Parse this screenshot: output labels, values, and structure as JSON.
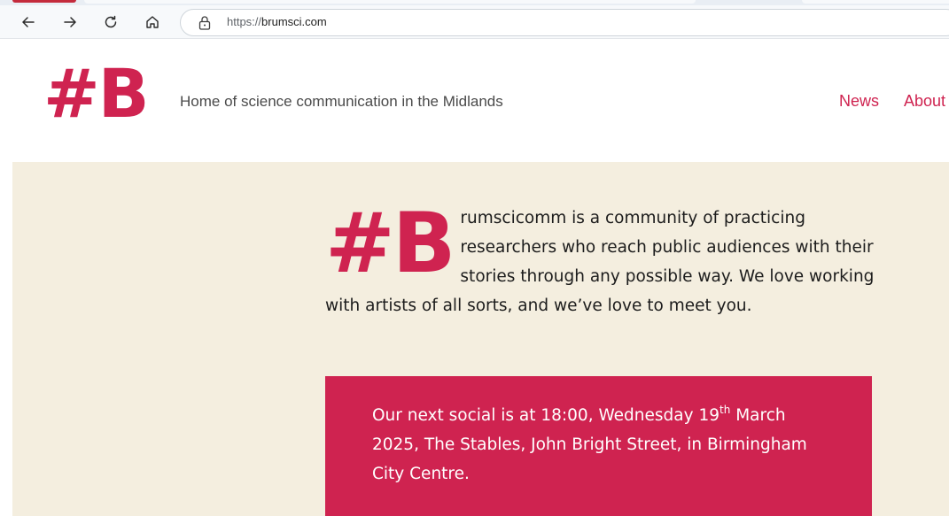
{
  "browser": {
    "url_scheme": "https://",
    "url_host": "brumsci.com"
  },
  "header": {
    "logo": "#B",
    "tagline": "Home of science communication in the Midlands",
    "nav": {
      "news": "News",
      "about": "About"
    }
  },
  "intro": {
    "dropcap": "#B",
    "text": "rumscicomm is a community of practicing researchers who reach public audiences with their stories through any possible way. We love working with artists of all sorts, and we’ve love to meet you."
  },
  "social": {
    "text_before_day": "Our next social is at 18:00, Wednesday 19",
    "day_suffix": "th",
    "text_after_day": " March 2025, The Stables, John Bright Street, in Birmingham City Centre."
  },
  "colors": {
    "brand": "#cf2350",
    "page_background": "#f4eedf"
  },
  "icons": {
    "back": "back-arrow-icon",
    "forward": "forward-arrow-icon",
    "reload": "reload-icon",
    "home": "home-icon",
    "site_info": "lock-icon"
  }
}
